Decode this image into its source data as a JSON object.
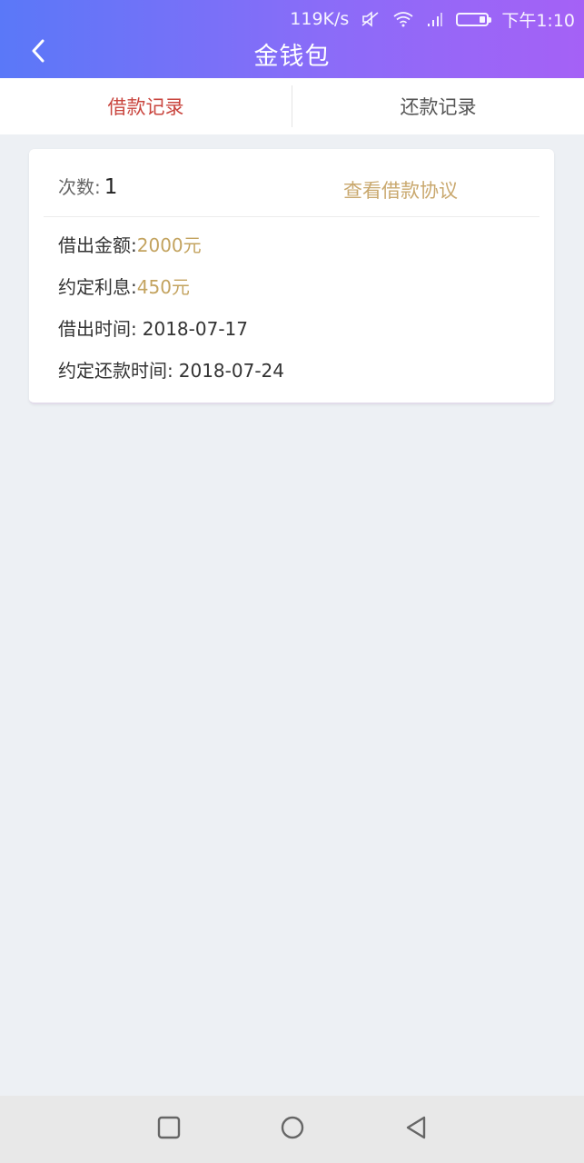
{
  "status": {
    "speed": "119K/s",
    "time": "下午1:10"
  },
  "header": {
    "title": "金钱包"
  },
  "tabs": [
    {
      "label": "借款记录",
      "active": true
    },
    {
      "label": "还款记录",
      "active": false
    }
  ],
  "record": {
    "count_label": "次数:",
    "count_value": "1",
    "agreement_link": "查看借款协议",
    "fields": [
      {
        "label": "借出金额:",
        "value": "2000元"
      },
      {
        "label": "约定利息:",
        "value": "450元"
      },
      {
        "label": "借出时间:",
        "value": "2018-07-17"
      },
      {
        "label": "约定还款时间:",
        "value": "2018-07-24"
      }
    ]
  },
  "colors": {
    "header_gradient_start": "#5a78f8",
    "header_gradient_end": "#a561f6",
    "active_tab": "#c9453e",
    "accent_gold": "#c3a35f",
    "background": "#edf0f4"
  },
  "icons": {
    "back": "chevron-left-icon",
    "nav_recent": "square-icon",
    "nav_home": "circle-icon",
    "nav_back": "triangle-back-icon"
  }
}
